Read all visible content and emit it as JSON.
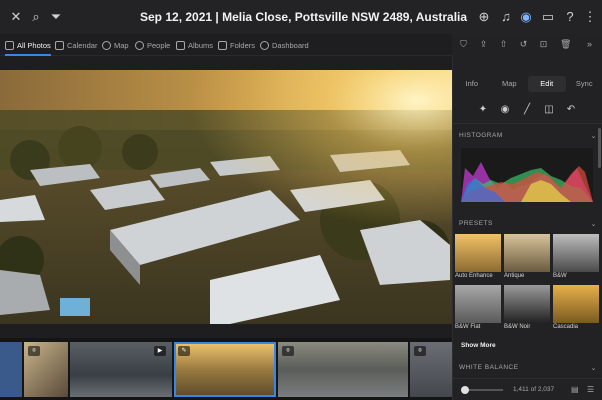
{
  "app": {
    "title": "Sep 12, 2021 | Melia Close, Pottsville NSW 2489, Australia"
  },
  "nav": {
    "items": [
      {
        "label": "All Photos",
        "icon": "grid-icon"
      },
      {
        "label": "Calendar",
        "icon": "calendar-icon"
      },
      {
        "label": "Map",
        "icon": "map-pin-icon"
      },
      {
        "label": "People",
        "icon": "people-icon"
      },
      {
        "label": "Albums",
        "icon": "album-icon"
      },
      {
        "label": "Folders",
        "icon": "folder-icon"
      },
      {
        "label": "Dashboard",
        "icon": "dashboard-icon"
      }
    ],
    "active": "All Photos"
  },
  "panel": {
    "tabs": [
      "Info",
      "Map",
      "Edit",
      "Sync"
    ],
    "active_tab": "Edit",
    "histogram_label": "HISTOGRAM",
    "presets_label": "PRESETS",
    "presets": [
      "Auto Enhance",
      "Antique",
      "B&W",
      "B&W Flat",
      "B&W Noir",
      "Cascadia"
    ],
    "show_more": "Show More",
    "white_balance_label": "WHITE BALANCE",
    "count": "1,411 of 2,037"
  },
  "colors": {
    "accent": "#3a86e8",
    "background": "#1e1e20",
    "panel": "#222224"
  }
}
